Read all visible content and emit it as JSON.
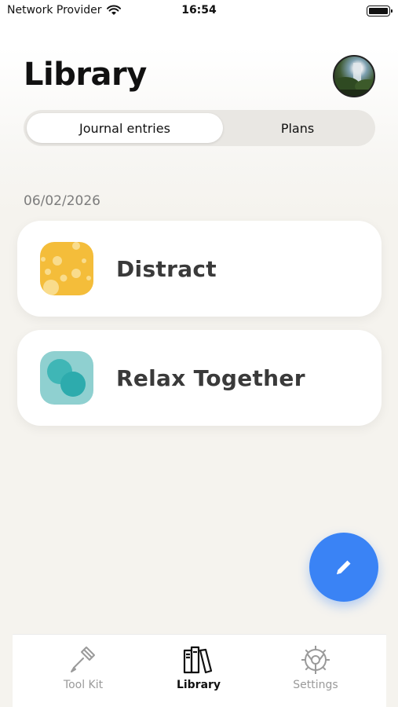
{
  "status_bar": {
    "carrier": "Network Provider",
    "time": "16:54",
    "wifi_icon": "wifi-icon",
    "battery_icon": "battery-icon"
  },
  "header": {
    "title": "Library",
    "avatar": "user-avatar"
  },
  "segmented_control": {
    "tabs": [
      {
        "label": "Journal entries",
        "selected": true
      },
      {
        "label": "Plans",
        "selected": false
      }
    ]
  },
  "entries": {
    "date": "06/02/2026",
    "items": [
      {
        "label": "Distract",
        "icon": "distract-bubbles-icon",
        "color": "#f4bd3a"
      },
      {
        "label": "Relax Together",
        "icon": "relax-together-circles-icon",
        "color": "#8fd0d0"
      }
    ]
  },
  "fab": {
    "icon": "pencil-icon",
    "color": "#3a83f5"
  },
  "tab_bar": {
    "tabs": [
      {
        "label": "Tool Kit",
        "icon": "screwdriver-icon",
        "selected": false
      },
      {
        "label": "Library",
        "icon": "books-icon",
        "selected": true
      },
      {
        "label": "Settings",
        "icon": "gear-icon",
        "selected": false
      }
    ]
  }
}
